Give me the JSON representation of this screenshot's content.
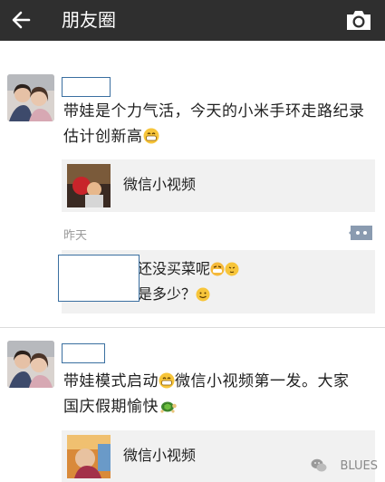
{
  "header": {
    "title": "朋友圈",
    "back_icon": "arrow-left-icon",
    "camera_icon": "camera-icon"
  },
  "posts": [
    {
      "text_line1": "带娃是个力气活，今天的小米手环走路纪录",
      "text_line2": "估计创新高",
      "link_label": "微信小视频",
      "time": "昨天",
      "comments": {
        "line1": "还没买菜呢",
        "line2": "是多少？"
      }
    },
    {
      "text_line1": "带娃模式启动",
      "text_line1b": "微信小视频第一发。大家",
      "text_line2": "国庆假期愉快",
      "link_label": "微信小视频"
    }
  ],
  "watermark": {
    "text": "BLUES"
  },
  "colors": {
    "topbar": "#2f2f2f",
    "card": "#f1f1f1",
    "name_border": "#3a6fa0"
  }
}
